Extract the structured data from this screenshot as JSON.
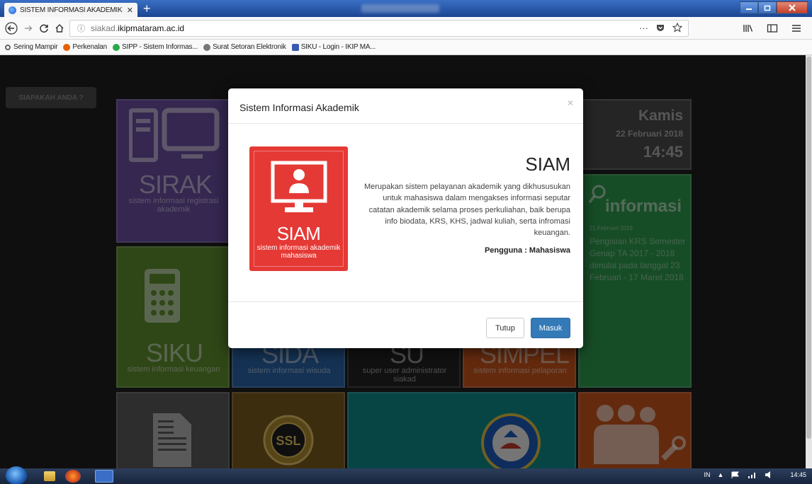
{
  "browser": {
    "tab_title": "SISTEM INFORMASI AKADEMIK",
    "tab_close": "✕",
    "new_tab": "+",
    "url_prefix": "siakad.",
    "url_domain": "ikipmataram.ac.id",
    "url_menu": "···",
    "bookmarks": [
      {
        "label": "Sering Mampir",
        "color": "#9a9a9a"
      },
      {
        "label": "Perkenalan",
        "color": "#e66000"
      },
      {
        "label": "SIPP - Sistem Informas...",
        "color": "#2aa84a"
      },
      {
        "label": "Surat Setoran Elektronik",
        "color": "#777777"
      },
      {
        "label": "SIKU - Login - IKIP MA...",
        "color": "#3b5bb0"
      }
    ]
  },
  "page": {
    "siapakah_label": "SIAPAKAH ANDA ?",
    "tiles": {
      "sirak": {
        "name": "SIRAK",
        "sub": "sistem informasi registrasi akademik",
        "color": "#6a4fa0"
      },
      "siku": {
        "name": "SIKU",
        "sub": "sistem informasi keuangan",
        "color": "#5e8f2f"
      },
      "sida": {
        "name": "SIDA",
        "sub": "sistem informasi wisuda",
        "color": "#2b65a8"
      },
      "su": {
        "name": "SU",
        "sub": "super user administrator siakad",
        "color": "#222222"
      },
      "simpel": {
        "name": "SIMPEL",
        "sub": "sistem informasi pelaporan",
        "color": "#c8541d"
      }
    },
    "clock": {
      "day": "Kamis",
      "date": "22 Februari 2018",
      "time": "14:45"
    },
    "info": {
      "title": "informasi",
      "date": "21 Februari 2018",
      "text": "Pengisian KRS Semester Genap TA 2017 - 2018 dimulai pada tanggal 23 Februari - 17 Maret 2018"
    }
  },
  "modal": {
    "title": "Sistem Informasi Akademik",
    "close": "×",
    "card_name": "SIAM",
    "card_sub": "sistem informasi akademik mahasiswa",
    "heading": "SIAM",
    "description": "Merupakan sistem pelayanan akademik yang dikhususukan untuk mahasiswa dalam mengakses informasi seputar catatan akademik selama proses perkuliahan, baik berupa info biodata, KRS, KHS, jadwal kuliah, serta infromasi keuangan.",
    "user_label": "Pengguna : Mahasiswa",
    "btn_close": "Tutup",
    "btn_submit": "Masuk",
    "accent": "#e53935",
    "primary": "#337ab7"
  },
  "taskbar": {
    "lang": "IN",
    "time": "14:45"
  }
}
